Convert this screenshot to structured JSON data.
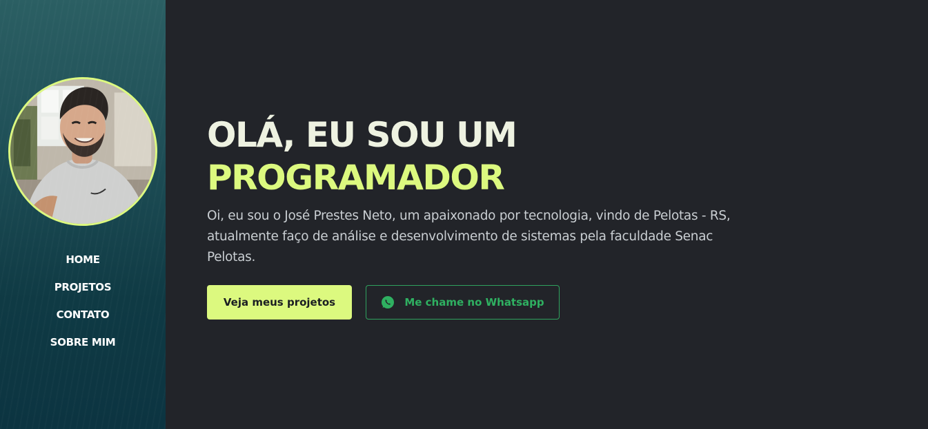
{
  "sidebar": {
    "nav": [
      {
        "label": "HOME"
      },
      {
        "label": "PROJETOS"
      },
      {
        "label": "CONTATO"
      },
      {
        "label": "SOBRE MIM"
      }
    ]
  },
  "hero": {
    "headline_line1": "OLÁ, EU SOU UM",
    "headline_line2": "PROGRAMADOR",
    "intro": "Oi, eu sou o José Prestes Neto, um apaixonado por tecnologia, vindo de Pelotas - RS, atualmente faço de análise e desenvolvimento de sistemas pela faculdade Senac Pelotas.",
    "primary_button": "Veja meus projetos",
    "secondary_button": "Me chame no Whatsapp",
    "secondary_icon": "whatsapp-icon"
  },
  "colors": {
    "accent": "#dcf97f",
    "background": "#222429",
    "sidebar": "#0f3a44",
    "whatsapp": "#2fb061"
  }
}
